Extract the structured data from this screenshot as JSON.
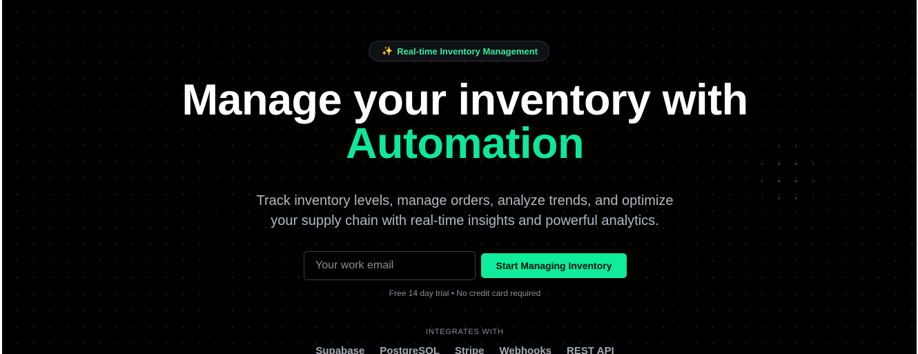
{
  "badge": {
    "icon": "sparkles-icon",
    "text": "Real-time Inventory Management"
  },
  "hero": {
    "headline_line1": "Manage your inventory with",
    "headline_line2": "Automation",
    "subtitle_line1": "Track inventory levels, manage orders, analyze trends, and optimize",
    "subtitle_line2": "your supply chain with real-time insights and powerful analytics."
  },
  "signup": {
    "email_placeholder": "Your work email",
    "email_value": "",
    "cta_label": "Start Managing Inventory",
    "note": "Free 14 day trial • No credit card required"
  },
  "integrations": {
    "label": "INTEGRATES WITH",
    "items": [
      "Supabase",
      "PostgreSQL",
      "Stripe",
      "Webhooks",
      "REST API"
    ]
  },
  "colors": {
    "background": "#000000",
    "accent": "#10e899",
    "button": "#10ec9a",
    "text": "#ffffff",
    "muted": "#b4b8c0"
  }
}
